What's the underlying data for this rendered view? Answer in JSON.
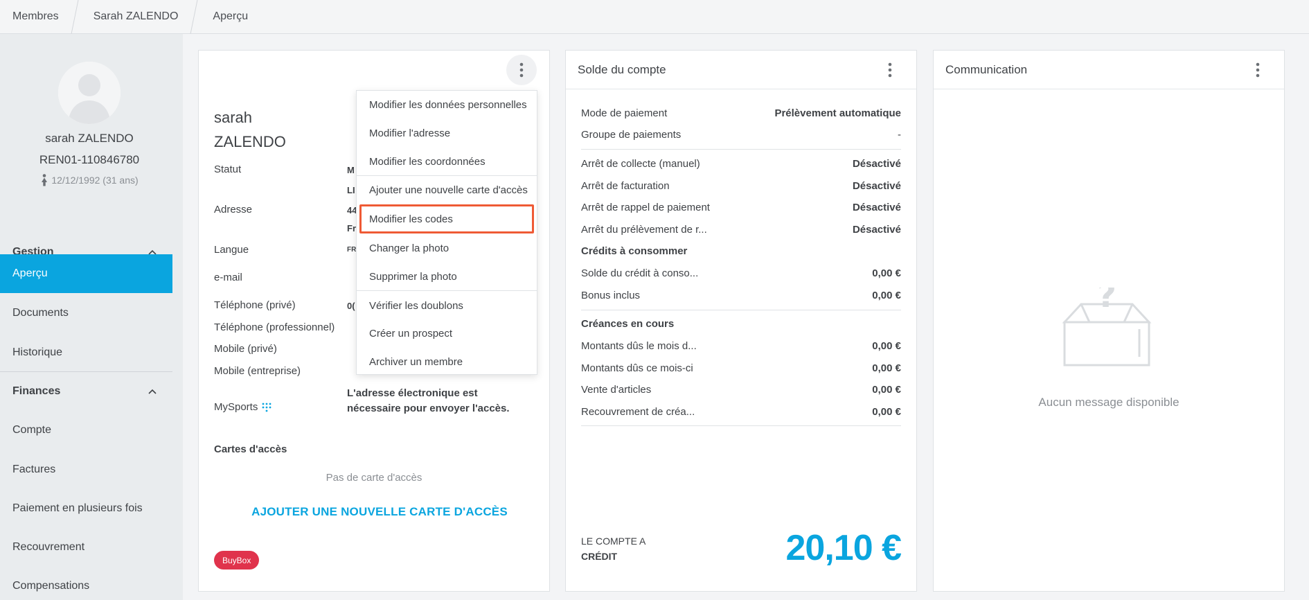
{
  "breadcrumb": [
    "Membres",
    "Sarah ZALENDO",
    "Aperçu"
  ],
  "profile": {
    "name": "sarah ZALENDO",
    "id": "REN01-110846780",
    "dob": "12/12/1992 (31 ans)"
  },
  "sidebar": {
    "sections": [
      {
        "label": "Gestion",
        "items": [
          "Aperçu",
          "Documents",
          "Historique"
        ]
      },
      {
        "label": "Finances",
        "items": [
          "Compte",
          "Factures",
          "Paiement en plusieurs fois",
          "Recouvrement",
          "Compensations"
        ]
      }
    ],
    "active": "Aperçu"
  },
  "personal": {
    "first_name": "sarah",
    "last_name": "ZALENDO",
    "fields": [
      {
        "label": "Statut",
        "value": "M"
      },
      {
        "label": "",
        "value": "LI"
      },
      {
        "label": "Adresse",
        "value": "44"
      },
      {
        "label": "",
        "value": "Fr"
      },
      {
        "label": "Langue",
        "value": "FR"
      },
      {
        "label": "e-mail",
        "value": ""
      },
      {
        "label": "Téléphone (privé)",
        "value": "0("
      },
      {
        "label": "Téléphone (professionnel)",
        "value": ""
      },
      {
        "label": "Mobile (privé)",
        "value": ""
      },
      {
        "label": "Mobile (entreprise)",
        "value": ""
      }
    ],
    "mysports_label": "MySports",
    "email_note": "L'adresse électronique est nécessaire pour envoyer l'accès.",
    "cards_title": "Cartes d'accès",
    "no_card": "Pas de carte d'accès",
    "add_card": "AJOUTER UNE NOUVELLE CARTE D'ACCÈS",
    "badge": "BuyBox"
  },
  "menu": {
    "items": [
      "Modifier les données personnelles",
      "Modifier l'adresse",
      "Modifier les coordonnées",
      "Ajouter une nouvelle carte d'accès",
      "Modifier les codes",
      "Changer la photo",
      "Supprimer la photo",
      "Vérifier les doublons",
      "Créer un prospect",
      "Archiver un membre"
    ],
    "highlighted": "Modifier les codes"
  },
  "balance": {
    "title": "Solde du compte",
    "rows1": [
      {
        "label": "Mode de paiement",
        "value": "Prélèvement automatique"
      },
      {
        "label": "Groupe de paiements",
        "value": "-"
      }
    ],
    "rows2": [
      {
        "label": "Arrêt de collecte (manuel)",
        "value": "Désactivé"
      },
      {
        "label": "Arrêt de facturation",
        "value": "Désactivé"
      },
      {
        "label": "Arrêt de rappel de paiement",
        "value": "Désactivé"
      },
      {
        "label": "Arrêt du prélèvement de r...",
        "value": "Désactivé"
      }
    ],
    "credits_title": "Crédits à consommer",
    "credits": [
      {
        "label": "Solde du crédit à conso...",
        "value": "0,00 €"
      },
      {
        "label": "Bonus inclus",
        "value": "0,00 €"
      }
    ],
    "claims_title": "Créances en cours",
    "claims": [
      {
        "label": "Montants dûs le mois d...",
        "value": "0,00 €"
      },
      {
        "label": "Montants dûs ce mois-ci",
        "value": "0,00 €"
      },
      {
        "label": "Vente d'articles",
        "value": "0,00 €"
      },
      {
        "label": "Recouvrement de créa...",
        "value": "0,00 €"
      }
    ],
    "footer_line1": "LE COMPTE A",
    "footer_line2": "CRÉDIT",
    "amount": "20,10 €"
  },
  "communication": {
    "title": "Communication",
    "empty": "Aucun message disponible"
  },
  "colors": {
    "accent": "#0aa5df",
    "highlight": "#ef5a35",
    "badge": "#e0334c"
  }
}
